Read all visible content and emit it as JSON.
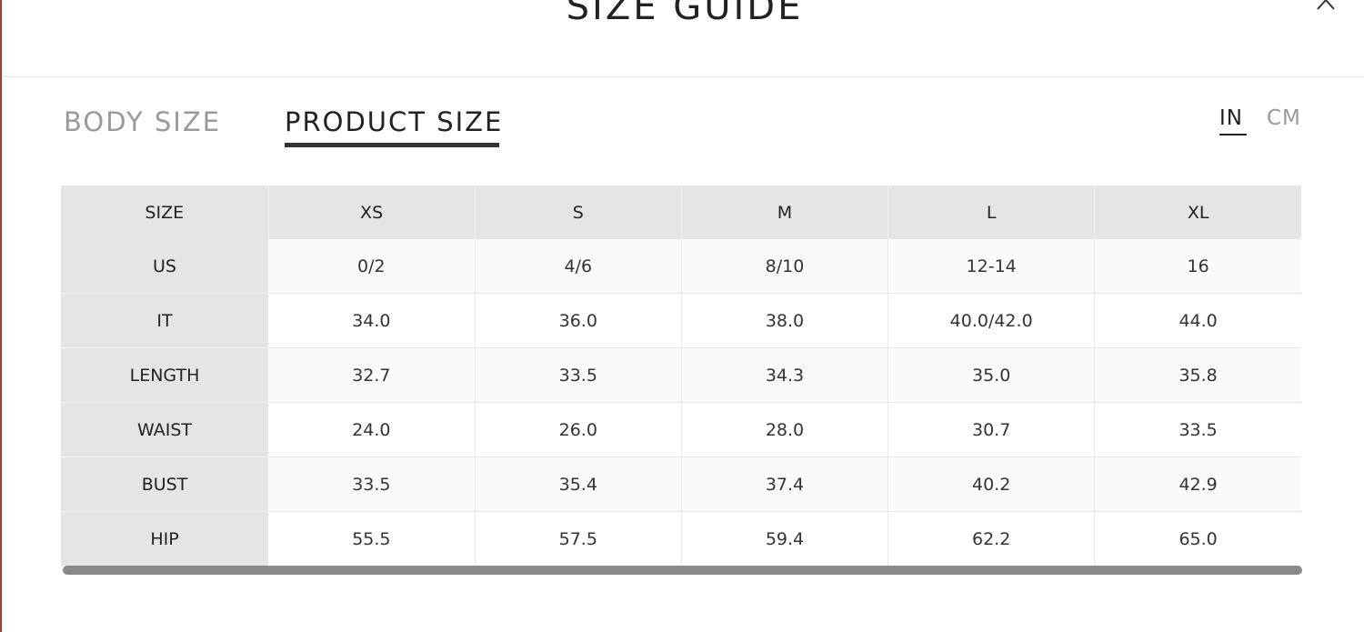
{
  "title": "SIZE GUIDE",
  "tabs": [
    {
      "label": "BODY SIZE",
      "active": false
    },
    {
      "label": "PRODUCT SIZE",
      "active": true
    }
  ],
  "units": [
    {
      "label": "IN",
      "active": true
    },
    {
      "label": "CM",
      "active": false
    }
  ],
  "table": {
    "headers": [
      "SIZE",
      "XS",
      "S",
      "M",
      "L",
      "XL"
    ],
    "rows": [
      {
        "label": "US",
        "values": [
          "0/2",
          "4/6",
          "8/10",
          "12-14",
          "16"
        ]
      },
      {
        "label": "IT",
        "values": [
          "34.0",
          "36.0",
          "38.0",
          "40.0/42.0",
          "44.0"
        ]
      },
      {
        "label": "LENGTH",
        "values": [
          "32.7",
          "33.5",
          "34.3",
          "35.0",
          "35.8"
        ]
      },
      {
        "label": "WAIST",
        "values": [
          "24.0",
          "26.0",
          "28.0",
          "30.7",
          "33.5"
        ]
      },
      {
        "label": "BUST",
        "values": [
          "33.5",
          "35.4",
          "37.4",
          "40.2",
          "42.9"
        ]
      },
      {
        "label": "HIP",
        "values": [
          "55.5",
          "57.5",
          "59.4",
          "62.2",
          "65.0"
        ]
      }
    ]
  },
  "colors": {
    "text_dark": "#222222",
    "text_muted": "#9a9a9a",
    "header_bg": "#e5e5e5",
    "scrollbar": "#8a8a8a"
  },
  "icons": {
    "close": "close-icon"
  }
}
